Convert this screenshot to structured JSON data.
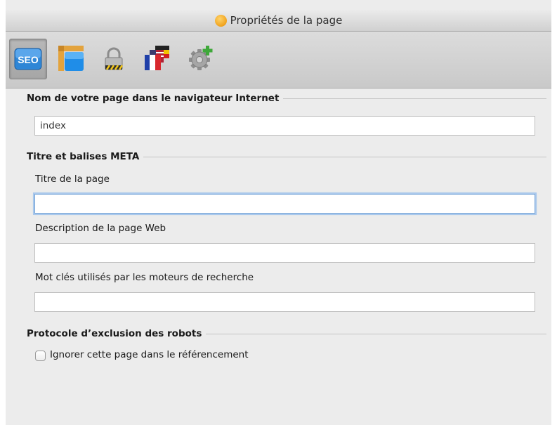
{
  "window": {
    "title": "Propriétés de la page"
  },
  "toolbar": {
    "items": [
      {
        "name": "seo",
        "label": "SEO",
        "active": true
      },
      {
        "name": "layout",
        "active": false
      },
      {
        "name": "lock",
        "active": false
      },
      {
        "name": "flags",
        "active": false
      },
      {
        "name": "gear-add",
        "active": false
      }
    ]
  },
  "sections": {
    "browser_name": {
      "header": "Nom de votre page dans le navigateur Internet",
      "value": "index"
    },
    "meta": {
      "header": "Titre et balises META",
      "title_label": "Titre de la page",
      "title_value": "",
      "description_label": "Description de la page Web",
      "description_value": "",
      "keywords_label": "Mot clés utilisés par les moteurs de recherche",
      "keywords_value": ""
    },
    "robots": {
      "header": "Protocole d’exclusion des robots",
      "checkbox_label": "Ignorer cette page dans le référencement",
      "checked": false
    }
  },
  "colors": {
    "seo_badge": "#2f86d6",
    "focus_ring": "#a9c8ec"
  }
}
